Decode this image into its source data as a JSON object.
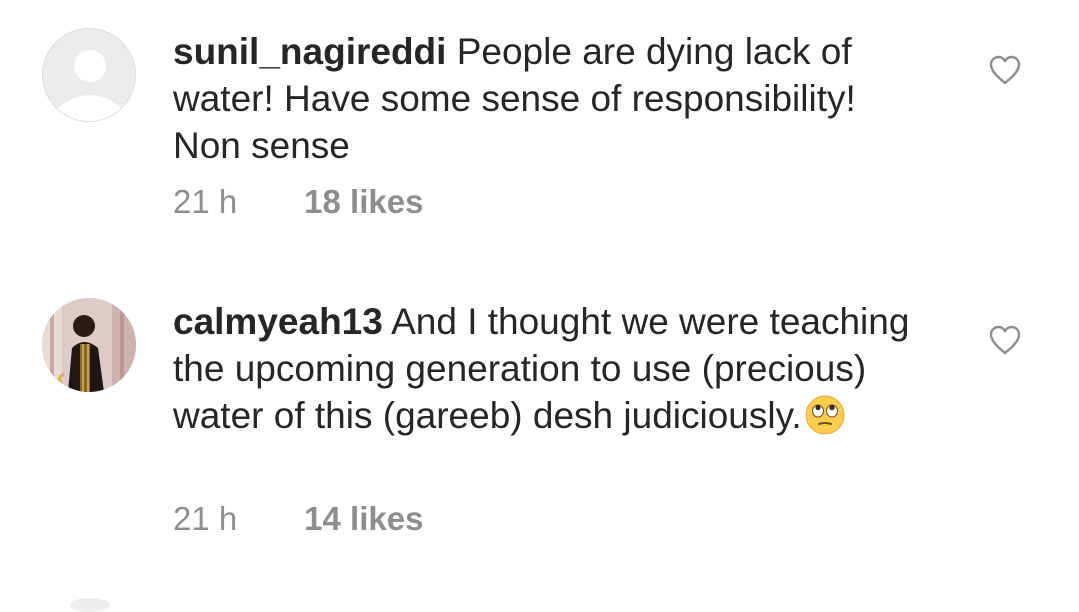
{
  "comments": [
    {
      "username": "sunil_nagireddi",
      "text": "People are dying lack of water! Have some sense of responsibility! Non sense",
      "time": "21 h",
      "likes": "18 likes",
      "avatar_icon": "default-user-avatar",
      "liked": false
    },
    {
      "username": "calmyeah13",
      "text": "And I thought we were teaching the upcoming generation to use (precious) water of this (gareeb) desh judiciously.",
      "emoji": "face-with-rolling-eyes",
      "time": "21 h",
      "likes": "14 likes",
      "avatar_icon": "profile-photo",
      "liked": false
    }
  ],
  "colors": {
    "text": "#262626",
    "secondary": "#8e8e8e",
    "heart_outline": "#8e8e8e",
    "emoji_face": "#FFCC4D"
  }
}
